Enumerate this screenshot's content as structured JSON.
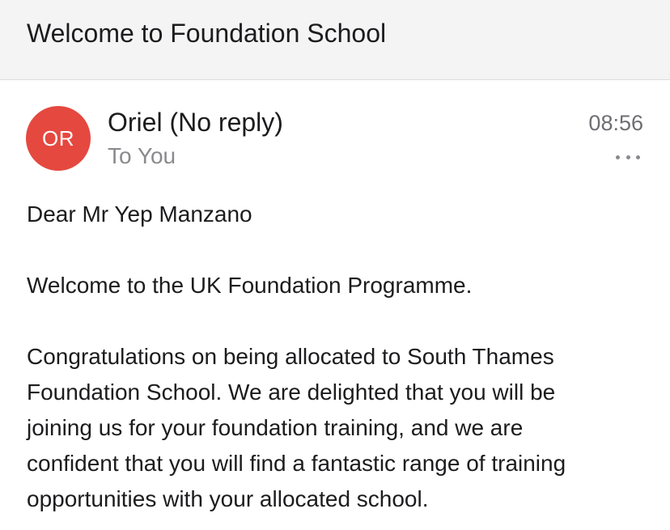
{
  "subject": "Welcome to Foundation School",
  "message": {
    "avatar_initials": "OR",
    "avatar_color": "#e5483f",
    "sender": "Oriel (No reply)",
    "recipient": "To You",
    "time": "08:56",
    "more_icon": "more-horizontal-icon"
  },
  "body": {
    "greeting": "Dear Mr Yep Manzano",
    "paragraph1": "Welcome to the UK Foundation Programme.",
    "paragraph2_lines": [
      "Congratulations on being allocated to South Thames",
      "Foundation School. We are delighted that you will be",
      "joining us for your foundation training, and we are",
      "confident that you will find a fantastic range of training",
      "opportunities with your allocated school."
    ]
  }
}
